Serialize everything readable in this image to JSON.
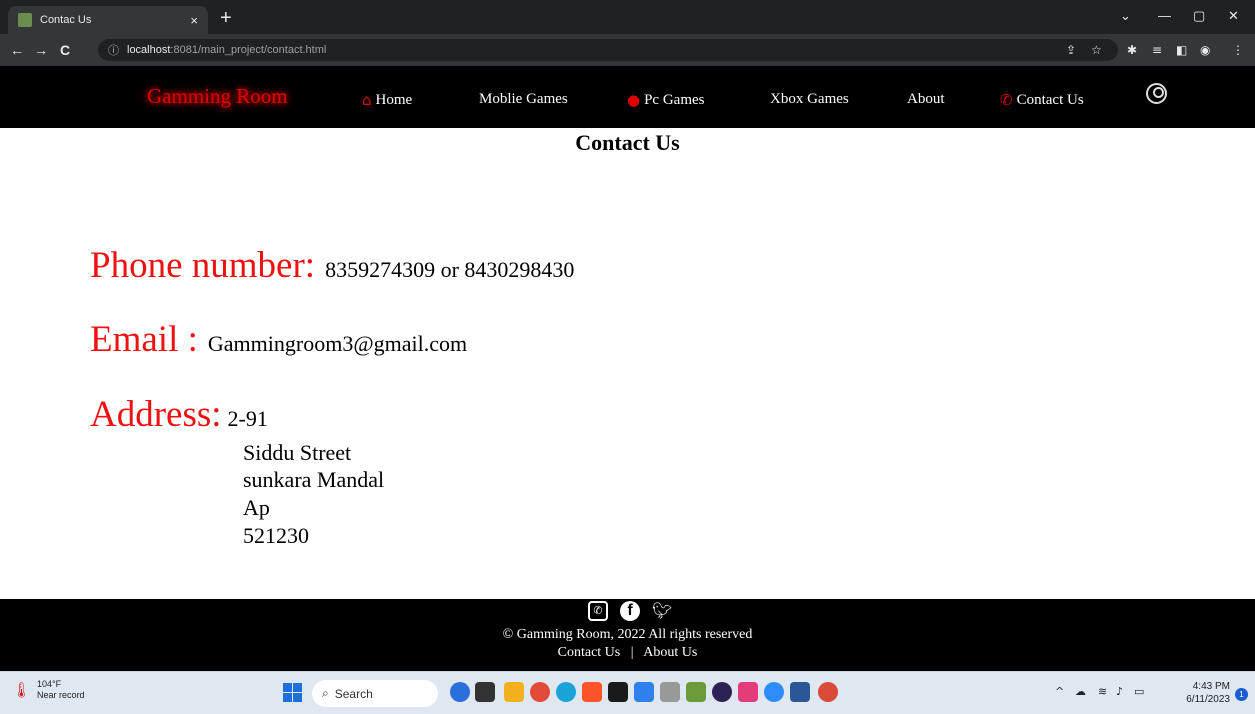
{
  "browser": {
    "tab_title": "Contac Us",
    "tab_close": "×",
    "new_tab": "+",
    "address_host": "localhost",
    "address_path": ":8081/main_project/contact.html"
  },
  "site": {
    "brand": "Gamming Room",
    "nav": [
      {
        "label": "Home",
        "icon": "home-icon"
      },
      {
        "label": "Moblie Games"
      },
      {
        "label": "Pc Games",
        "icon": "gamepad-icon"
      },
      {
        "label": "Xbox Games"
      },
      {
        "label": "About"
      },
      {
        "label": "Contact Us",
        "icon": "phone-icon"
      }
    ]
  },
  "main": {
    "title": "Contact Us",
    "phone_label": "Phone number:",
    "phone_value": "8359274309 or 8430298430",
    "email_label": "Email :",
    "email_value": "Gammingroom3@gmail.com",
    "address_label": "Address:",
    "address_lines": [
      "2-91",
      "Siddu Street",
      "sunkara Mandal",
      "Ap",
      "521230"
    ]
  },
  "footer": {
    "copyright": "© Gamming Room, 2022 All rights reserved",
    "link_contact": "Contact Us",
    "separator": "|",
    "link_about": "About Us",
    "social_icons": [
      "whatsapp-icon",
      "facebook-icon",
      "twitter-icon"
    ]
  },
  "taskbar": {
    "weather_temp": "104°F",
    "weather_desc": "Near record",
    "search_label": "Search",
    "time": "4:43 PM",
    "date": "6/11/2023",
    "notification_count": "1"
  },
  "colors": {
    "brand_red": "#e10000",
    "label_red": "#ee1111",
    "nav_bg": "#000000"
  }
}
